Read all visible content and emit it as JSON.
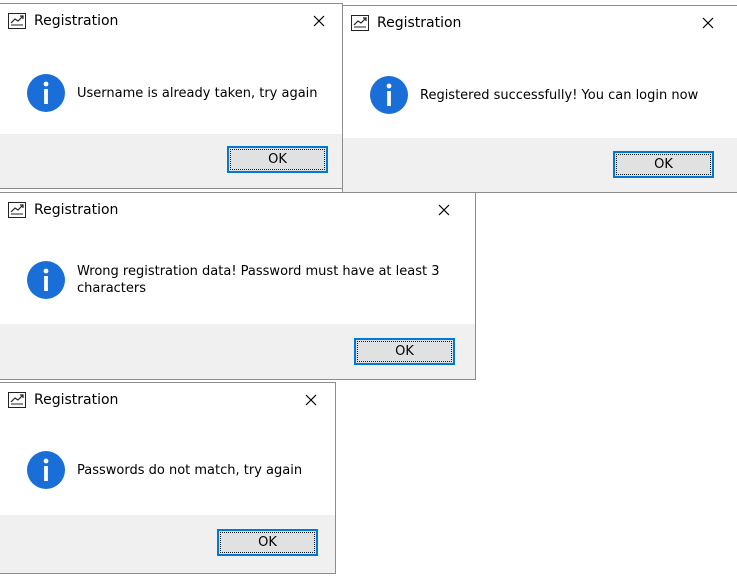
{
  "dialogs": [
    {
      "title": "Registration",
      "message": "Username is already taken, try again",
      "ok_label": "OK"
    },
    {
      "title": "Registration",
      "message": "Registered successfully! You can login now",
      "ok_label": "OK"
    },
    {
      "title": "Registration",
      "message": "Wrong registration data! Password must have at least 3 characters",
      "ok_label": "OK"
    },
    {
      "title": "Registration",
      "message": "Passwords do not match, try again",
      "ok_label": "OK"
    }
  ],
  "icons": {
    "app": "registration-app-icon",
    "info": "information-icon",
    "close": "close-icon"
  },
  "colors": {
    "info_blue": "#1a6ed8",
    "button_focus_border": "#0078d7",
    "button_face": "#e1e1e1",
    "footer_bg": "#f0f0f0"
  }
}
